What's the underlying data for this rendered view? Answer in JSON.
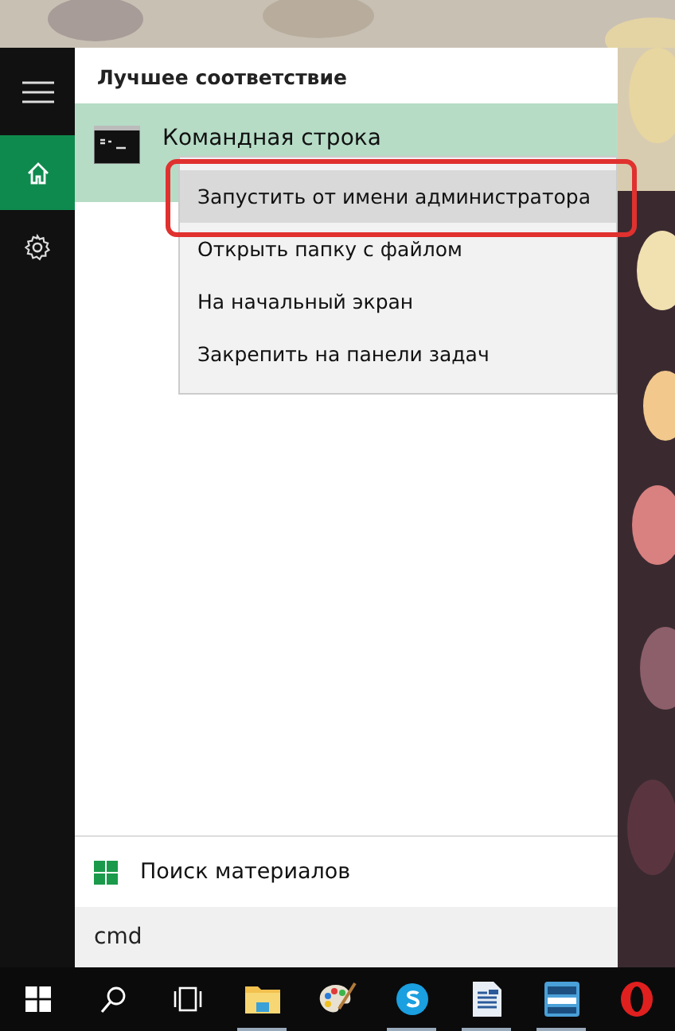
{
  "sidebar": {
    "items": [
      {
        "kind": "menu",
        "selected": false
      },
      {
        "kind": "home",
        "selected": true
      },
      {
        "kind": "settings",
        "selected": false
      }
    ]
  },
  "results": {
    "header": "Лучшее соответствие",
    "best_match": {
      "title": "Командная строка",
      "selected": true
    }
  },
  "context_menu": {
    "items": [
      {
        "label": "Запустить от имени администратора",
        "selected": true,
        "highlighted": true
      },
      {
        "label": "Открыть папку с файлом",
        "selected": false,
        "highlighted": false
      },
      {
        "label": "На начальный экран",
        "selected": false,
        "highlighted": false
      },
      {
        "label": "Закрепить на панели задач",
        "selected": false,
        "highlighted": false
      }
    ]
  },
  "web_search": {
    "label": "Поиск материалов"
  },
  "search": {
    "value": "cmd"
  },
  "taskbar": {
    "items": [
      {
        "kind": "start",
        "running": false
      },
      {
        "kind": "search",
        "running": false
      },
      {
        "kind": "taskview",
        "running": false
      },
      {
        "kind": "folder",
        "running": true
      },
      {
        "kind": "paint",
        "running": false
      },
      {
        "kind": "skype",
        "running": true
      },
      {
        "kind": "document",
        "running": true
      },
      {
        "kind": "app",
        "running": true
      },
      {
        "kind": "opera",
        "running": false
      }
    ]
  }
}
